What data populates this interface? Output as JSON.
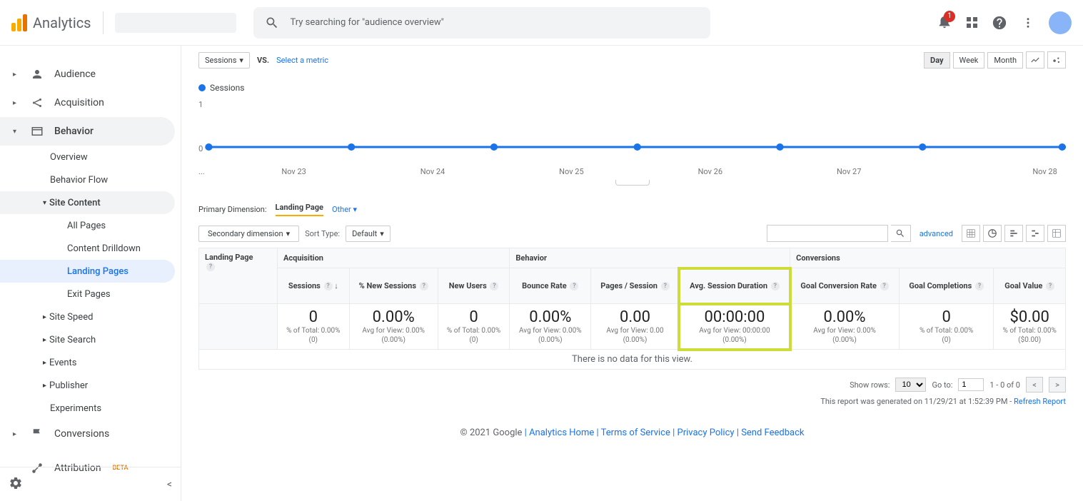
{
  "header": {
    "title": "Analytics",
    "search_placeholder": "Try searching for \"audience overview\"",
    "notif_count": "1"
  },
  "sidebar": {
    "audience": "Audience",
    "acquisition": "Acquisition",
    "behavior": "Behavior",
    "overview": "Overview",
    "behavior_flow": "Behavior Flow",
    "site_content": "Site Content",
    "all_pages": "All Pages",
    "content_drilldown": "Content Drilldown",
    "landing_pages": "Landing Pages",
    "exit_pages": "Exit Pages",
    "site_speed": "Site Speed",
    "site_search": "Site Search",
    "events": "Events",
    "publisher": "Publisher",
    "experiments": "Experiments",
    "conversions": "Conversions",
    "attribution": "Attribution",
    "attribution_tag": "BETA"
  },
  "chartControls": {
    "metric1": "Sessions",
    "vs": "VS.",
    "selectMetric": "Select a metric",
    "timeOptions": [
      "Day",
      "Week",
      "Month"
    ],
    "activeTimeOption": 0,
    "legend": "Sessions"
  },
  "chart_data": {
    "type": "line",
    "title": "Sessions",
    "xlabel": "",
    "ylabel": "",
    "ylim": [
      0,
      1
    ],
    "categories": [
      "...",
      "Nov 23",
      "Nov 24",
      "Nov 25",
      "Nov 26",
      "Nov 27",
      "Nov 28"
    ],
    "series": [
      {
        "name": "Sessions",
        "values": [
          0,
          0,
          0,
          0,
          0,
          0,
          0
        ],
        "color": "#1a73e8"
      }
    ],
    "y_ticks": [
      0,
      1
    ]
  },
  "dimension": {
    "primaryLabel": "Primary Dimension:",
    "primaryValue": "Landing Page",
    "other": "Other",
    "secondary": "Secondary dimension",
    "sortTypeLabel": "Sort Type:",
    "sortDefault": "Default",
    "advanced": "advanced"
  },
  "table": {
    "dimCol": "Landing Page",
    "groups": {
      "acquisition": "Acquisition",
      "behavior": "Behavior",
      "conversions": "Conversions"
    },
    "cols": [
      {
        "label": "Sessions",
        "value": "0",
        "sub1": "% of Total: 0.00%",
        "sub2": "(0)",
        "sort": true
      },
      {
        "label": "% New Sessions",
        "value": "0.00%",
        "sub1": "Avg for View: 0.00%",
        "sub2": "(0.00%)"
      },
      {
        "label": "New Users",
        "value": "0",
        "sub1": "% of Total: 0.00%",
        "sub2": "(0)"
      },
      {
        "label": "Bounce Rate",
        "value": "0.00%",
        "sub1": "Avg for View: 0.00%",
        "sub2": "(0.00%)"
      },
      {
        "label": "Pages / Session",
        "value": "0.00",
        "sub1": "Avg for View: 0.00",
        "sub2": "(0.00%)"
      },
      {
        "label": "Avg. Session Duration",
        "value": "00:00:00",
        "sub1": "Avg for View: 00:00:00",
        "sub2": "(0.00%)",
        "highlight": true
      },
      {
        "label": "Goal Conversion Rate",
        "value": "0.00%",
        "sub1": "Avg for View: 0.00%",
        "sub2": "(0.00%)"
      },
      {
        "label": "Goal Completions",
        "value": "0",
        "sub1": "% of Total: 0.00%",
        "sub2": "(0)"
      },
      {
        "label": "Goal Value",
        "value": "$0.00",
        "sub1": "% of Total: 0.00%",
        "sub2": "($0.00)"
      }
    ],
    "noData": "There is no data for this view."
  },
  "pager": {
    "showRows": "Show rows:",
    "rowsValue": "10",
    "goTo": "Go to:",
    "goToValue": "1",
    "range": "1 - 0 of 0"
  },
  "generated": {
    "text": "This report was generated on 11/29/21 at 1:52:39 PM - ",
    "refresh": "Refresh Report"
  },
  "footer": {
    "copyright": "© 2021 Google",
    "links": [
      "Analytics Home",
      "Terms of Service",
      "Privacy Policy",
      "Send Feedback"
    ]
  }
}
